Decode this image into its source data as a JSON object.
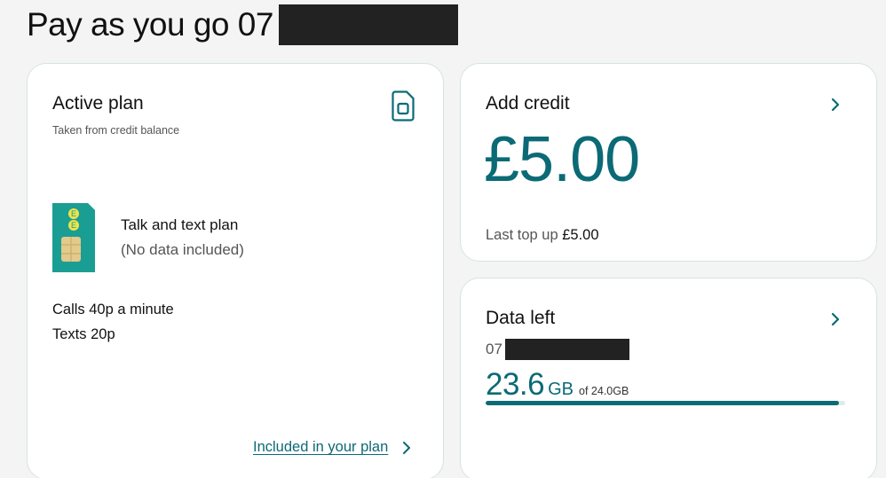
{
  "header": {
    "title": "Pay as you go 07"
  },
  "active_plan": {
    "heading": "Active plan",
    "subtitle": "Taken from credit balance",
    "plan_name": "Talk and text plan",
    "plan_note": "(No data included)",
    "calls_rate": "Calls 40p a minute",
    "texts_rate": "Texts 20p",
    "link_label": "Included in your plan"
  },
  "add_credit": {
    "heading": "Add credit",
    "amount": "£5.00",
    "last_topup_label": "Last top up",
    "last_topup_value": "£5.00"
  },
  "data_left": {
    "heading": "Data left",
    "number_prefix": "07",
    "remaining_value": "23.6",
    "remaining_unit": "GB",
    "allowance_text": "of 24.0GB",
    "fraction_remaining": 0.983
  },
  "colors": {
    "accent": "#0b6a76",
    "sim_green": "#1a9e93",
    "chip_gold": "#e3c98c"
  },
  "icons": [
    "sim-card-outline-icon",
    "chevron-right-icon",
    "ee-sim-card-icon"
  ]
}
